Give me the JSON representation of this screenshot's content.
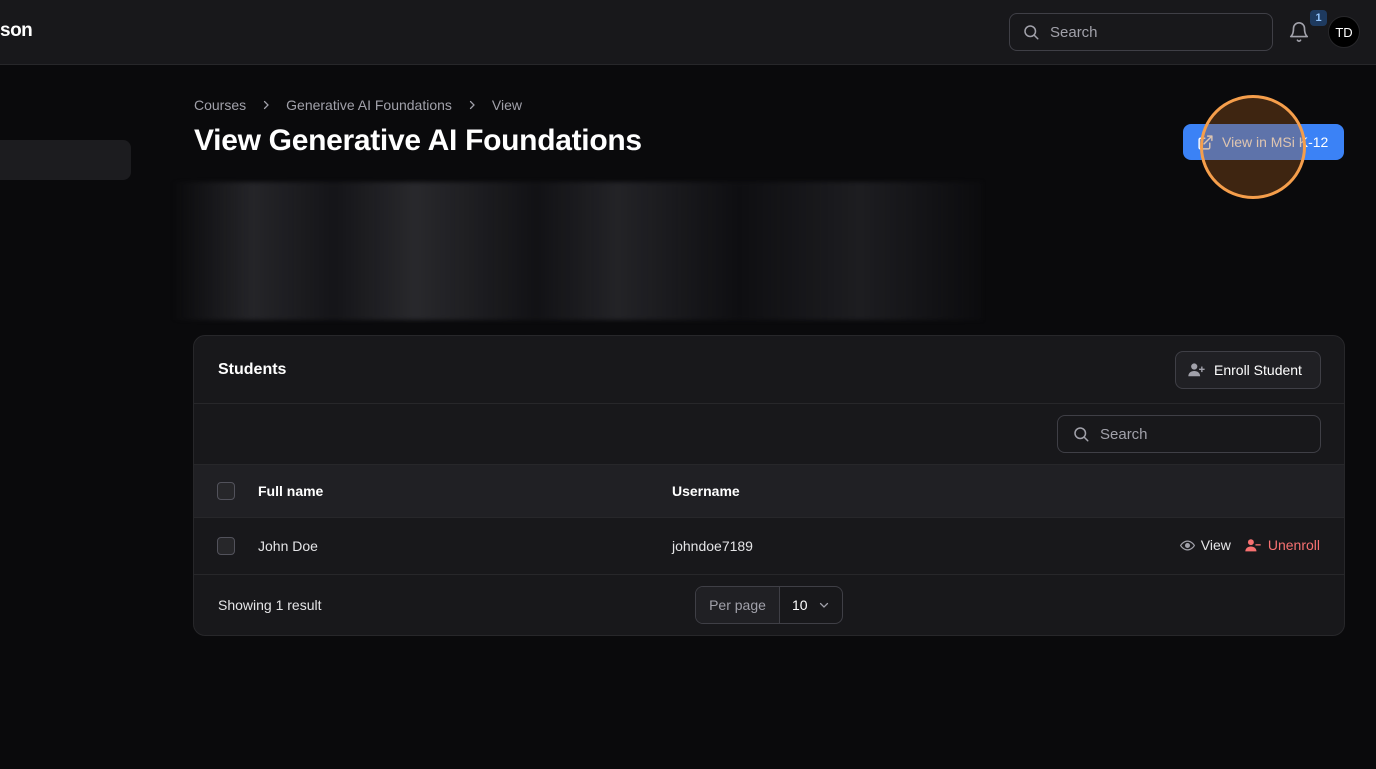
{
  "app": {
    "logo_text": "son"
  },
  "topbar": {
    "search_placeholder": "Search",
    "notification_count": "1",
    "avatar_initials": "TD"
  },
  "breadcrumb": [
    "Courses",
    "Generative AI Foundations",
    "View"
  ],
  "page": {
    "title": "View Generative AI Foundations",
    "primary_action": "View in MSi K-12"
  },
  "students": {
    "title": "Students",
    "enroll_label": "Enroll Student",
    "search_placeholder": "Search",
    "columns": {
      "full_name": "Full name",
      "username": "Username"
    },
    "rows": [
      {
        "full_name": "John Doe",
        "username": "johndoe7189",
        "view_label": "View",
        "unenroll_label": "Unenroll"
      }
    ],
    "result_text": "Showing 1 result",
    "per_page_label": "Per page",
    "per_page_value": "10"
  },
  "colors": {
    "accent": "#3b82f6",
    "danger": "#f87171",
    "highlight": "#f59e4b"
  }
}
